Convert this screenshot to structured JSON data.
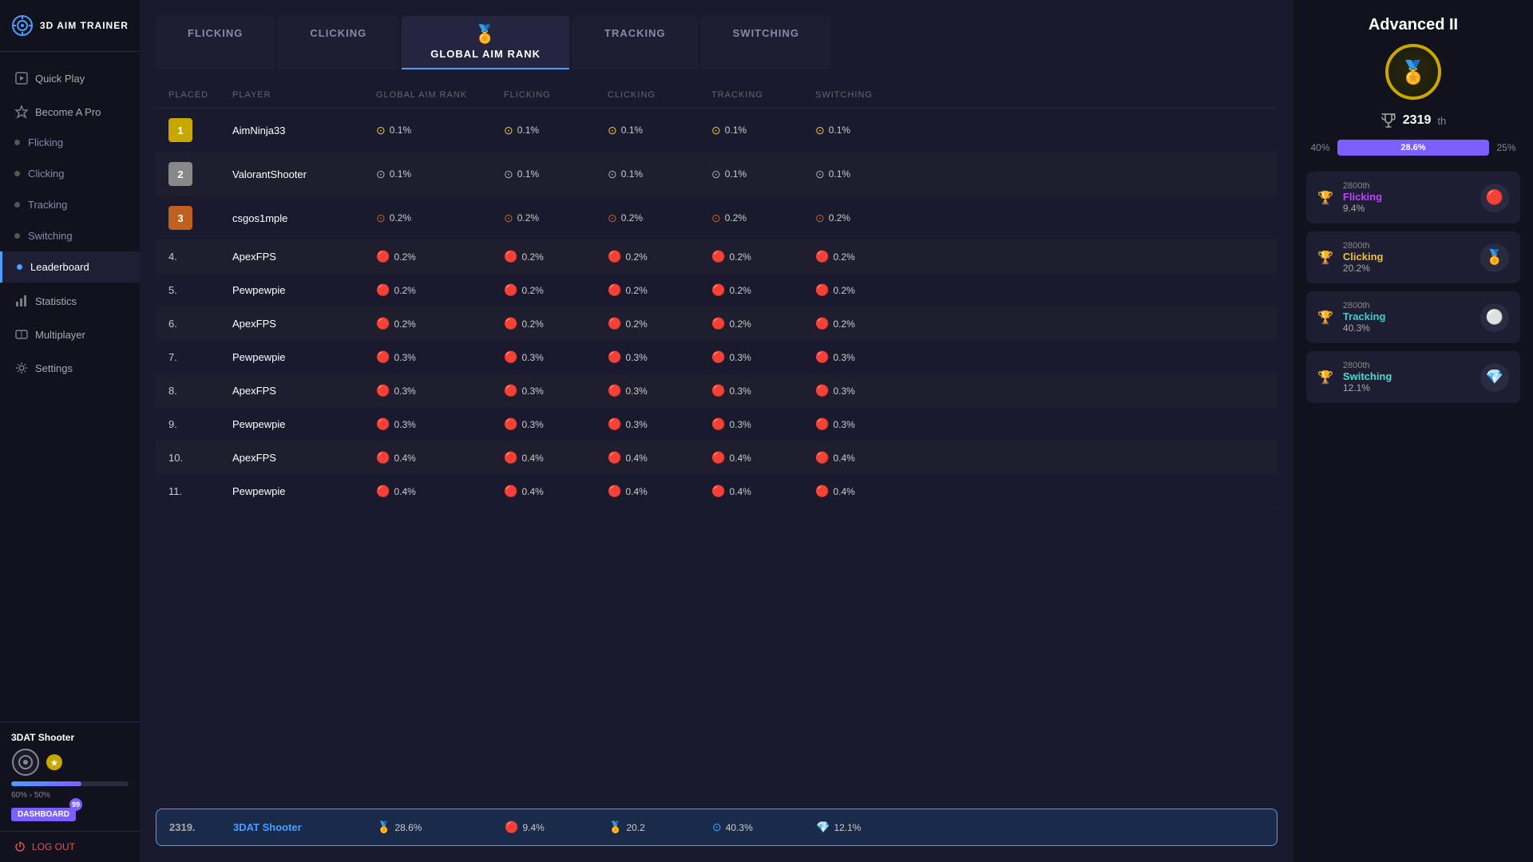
{
  "sidebar": {
    "logo": "3D AIM TRAINER",
    "nav": [
      {
        "id": "quickplay",
        "label": "Quick Play",
        "icon": "🎮",
        "dot": false,
        "active": false
      },
      {
        "id": "becomepro",
        "label": "Become A Pro",
        "icon": "⭐",
        "dot": false,
        "active": false
      },
      {
        "id": "flicking",
        "label": "Flicking",
        "dot": true,
        "active": false
      },
      {
        "id": "clicking",
        "label": "Clicking",
        "dot": true,
        "active": false
      },
      {
        "id": "tracking",
        "label": "Tracking",
        "dot": true,
        "active": false
      },
      {
        "id": "switching",
        "label": "Switching",
        "dot": true,
        "active": false
      },
      {
        "id": "leaderboard",
        "label": "Leaderboard",
        "dot": true,
        "active": true
      },
      {
        "id": "statistics",
        "label": "Statistics",
        "icon": "📊",
        "dot": false,
        "active": false
      },
      {
        "id": "multiplayer",
        "label": "Multiplayer",
        "icon": "🎮",
        "dot": false,
        "active": false
      },
      {
        "id": "settings",
        "label": "Settings",
        "icon": "⚙️",
        "dot": false,
        "active": false
      }
    ],
    "profile": {
      "name": "3DAT Shooter",
      "progress_from": "60%",
      "progress_to": "50%",
      "progress_val": 60,
      "dashboard_label": "DASHBOARD",
      "badge": "99"
    },
    "logout": "LOG OUT"
  },
  "tabs": [
    {
      "id": "flicking",
      "label": "FLICKING",
      "icon": "",
      "active": false
    },
    {
      "id": "clicking",
      "label": "CLICKING",
      "icon": "",
      "active": false
    },
    {
      "id": "global",
      "label": "GLOBAL AIM RANK",
      "icon": "🏅",
      "active": true
    },
    {
      "id": "tracking",
      "label": "TRACKING",
      "icon": "",
      "active": false
    },
    {
      "id": "switching",
      "label": "SWITCHING",
      "icon": "",
      "active": false
    }
  ],
  "table": {
    "headers": [
      "PLACED",
      "PLAYER",
      "GLOBAL AIM RANK",
      "FLICKING",
      "CLICKING",
      "TRACKING",
      "SWITCHING"
    ],
    "rows": [
      {
        "place": "1",
        "player": "AimNinja33",
        "global": "0.1%",
        "flicking": "0.1%",
        "clicking": "0.1%",
        "tracking": "0.1%",
        "switching": "0.1%",
        "rankType": "gold"
      },
      {
        "place": "2",
        "player": "ValorantShooter",
        "global": "0.1%",
        "flicking": "0.1%",
        "clicking": "0.1%",
        "tracking": "0.1%",
        "switching": "0.1%",
        "rankType": "silver"
      },
      {
        "place": "3",
        "player": "csgos1mple",
        "global": "0.2%",
        "flicking": "0.2%",
        "clicking": "0.2%",
        "tracking": "0.2%",
        "switching": "0.2%",
        "rankType": "bronze"
      },
      {
        "place": "4.",
        "player": "ApexFPS",
        "global": "0.2%",
        "flicking": "0.2%",
        "clicking": "0.2%",
        "tracking": "0.2%",
        "switching": "0.2%",
        "rankType": "default"
      },
      {
        "place": "5.",
        "player": "Pewpewpie",
        "global": "0.2%",
        "flicking": "0.2%",
        "clicking": "0.2%",
        "tracking": "0.2%",
        "switching": "0.2%",
        "rankType": "default"
      },
      {
        "place": "6.",
        "player": "ApexFPS",
        "global": "0.2%",
        "flicking": "0.2%",
        "clicking": "0.2%",
        "tracking": "0.2%",
        "switching": "0.2%",
        "rankType": "default"
      },
      {
        "place": "7.",
        "player": "Pewpewpie",
        "global": "0.3%",
        "flicking": "0.3%",
        "clicking": "0.3%",
        "tracking": "0.3%",
        "switching": "0.3%",
        "rankType": "default"
      },
      {
        "place": "8.",
        "player": "ApexFPS",
        "global": "0.3%",
        "flicking": "0.3%",
        "clicking": "0.3%",
        "tracking": "0.3%",
        "switching": "0.3%",
        "rankType": "default"
      },
      {
        "place": "9.",
        "player": "Pewpewpie",
        "global": "0.3%",
        "flicking": "0.3%",
        "clicking": "0.3%",
        "tracking": "0.3%",
        "switching": "0.3%",
        "rankType": "default"
      },
      {
        "place": "10.",
        "player": "ApexFPS",
        "global": "0.4%",
        "flicking": "0.4%",
        "clicking": "0.4%",
        "tracking": "0.4%",
        "switching": "0.4%",
        "rankType": "default"
      },
      {
        "place": "11.",
        "player": "Pewpewpie",
        "global": "0.4%",
        "flicking": "0.4%",
        "clicking": "0.4%",
        "tracking": "0.4%",
        "switching": "0.4%",
        "rankType": "default"
      }
    ],
    "user_row": {
      "place": "2319.",
      "player": "3DAT Shooter",
      "global": "28.6%",
      "flicking": "9.4%",
      "clicking": "20.2",
      "tracking": "40.3%",
      "switching": "12.1%"
    }
  },
  "right_panel": {
    "rank_title": "Advanced II",
    "rank_icon": "🏅",
    "position": "2319",
    "position_suffix": "th",
    "bar_left": "40%",
    "bar_center": "28.6%",
    "bar_right": "25%",
    "skills": [
      {
        "id": "flicking",
        "name": "Flicking",
        "rank": "2800th",
        "pct": "9.4%",
        "color": "color-purple",
        "icon": "🔴"
      },
      {
        "id": "clicking",
        "name": "Clicking",
        "rank": "2800th",
        "pct": "20.2%",
        "color": "color-gold",
        "icon": "🏅"
      },
      {
        "id": "tracking",
        "name": "Tracking",
        "rank": "2800th",
        "pct": "40.3%",
        "color": "color-cyan",
        "icon": "⚪"
      },
      {
        "id": "switching",
        "name": "Switching",
        "rank": "2800th",
        "pct": "12.1%",
        "color": "color-teal",
        "icon": "💎"
      }
    ]
  }
}
